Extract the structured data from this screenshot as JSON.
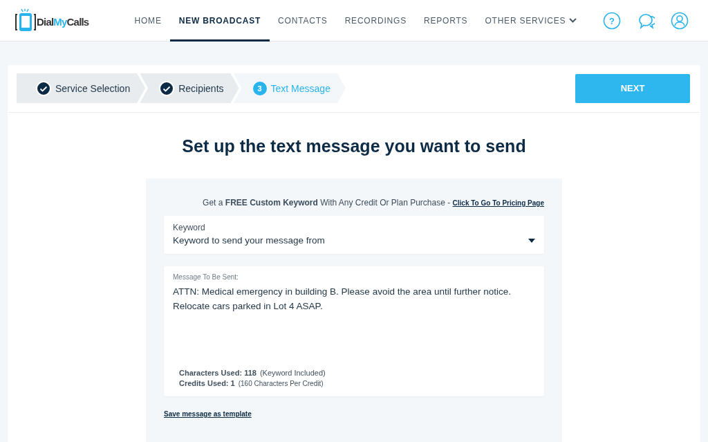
{
  "logo": {
    "parts": [
      {
        "text": "Dial",
        "accent": false
      },
      {
        "text": "My",
        "accent": true
      },
      {
        "text": "Calls",
        "accent": false
      }
    ]
  },
  "nav": [
    {
      "label": "HOME",
      "selected": false,
      "kind": "link"
    },
    {
      "label": "NEW BROADCAST",
      "selected": true,
      "kind": "link"
    },
    {
      "label": "CONTACTS",
      "selected": false,
      "kind": "link"
    },
    {
      "label": "RECORDINGS",
      "selected": false,
      "kind": "link"
    },
    {
      "label": "REPORTS",
      "selected": false,
      "kind": "link"
    },
    {
      "label": "OTHER SERVICES",
      "selected": false,
      "kind": "dropdown"
    }
  ],
  "header_icons": [
    {
      "kind": "help",
      "glyph": "?"
    },
    {
      "kind": "chat"
    },
    {
      "kind": "user"
    }
  ],
  "steps": [
    {
      "label": "Service Selection",
      "completed": true,
      "selected": false
    },
    {
      "label": "Recipients",
      "completed": true,
      "selected": false
    },
    {
      "label": "Text Message",
      "completed": false,
      "selected": true,
      "number": "3"
    }
  ],
  "next_button": "NEXT",
  "heading": "Set up the text message you want to send",
  "promo": {
    "text": "Get a **FREE Custom Keyword** With Any Credit Or Plan Purchase - ",
    "link": "Click To Go To Pricing Page"
  },
  "keyword_field": {
    "label": "Keyword",
    "value": "Keyword to send your message from"
  },
  "message_field": {
    "label": "Message To Be Sent:",
    "value": "ATTN: Medical emergency in building B. Please avoid the area until further notice. Relocate cars parked in Lot 4 ASAP."
  },
  "stats": [
    {
      "label": "Characters Used: 118",
      "note": "(Keyword Included)"
    },
    {
      "label": "Credits Used: 1",
      "note": "(160 Characters Per Credit)"
    }
  ],
  "save_link": "Save message as template"
}
